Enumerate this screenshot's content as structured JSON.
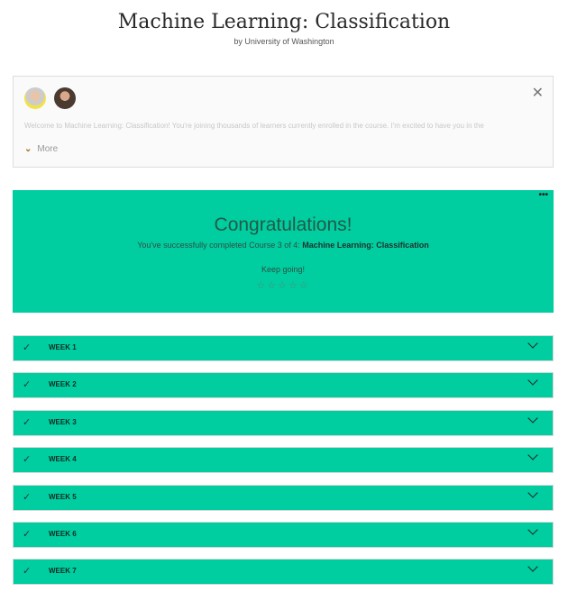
{
  "header": {
    "title": "Machine Learning: Classification",
    "subtitle": "by University of Washington"
  },
  "welcome": {
    "text": "Welcome to Machine Learning: Classification! You're joining thousands of learners currently enrolled in the course. I'm excited to have you in the",
    "more_label": "More",
    "close_icon": "close-icon"
  },
  "congrats": {
    "heading": "Congratulations!",
    "line_prefix": "You've successfully completed Course 3 of 4:",
    "course_name": "Machine Learning: Classification",
    "keep_going": "Keep going!",
    "rating": 0,
    "max_rating": 5,
    "menu": "•••"
  },
  "weeks": [
    {
      "label": "WEEK 1"
    },
    {
      "label": "WEEK 2"
    },
    {
      "label": "WEEK 3"
    },
    {
      "label": "WEEK 4"
    },
    {
      "label": "WEEK 5"
    },
    {
      "label": "WEEK 6"
    },
    {
      "label": "WEEK 7"
    }
  ],
  "colors": {
    "accent": "#00cea0"
  }
}
